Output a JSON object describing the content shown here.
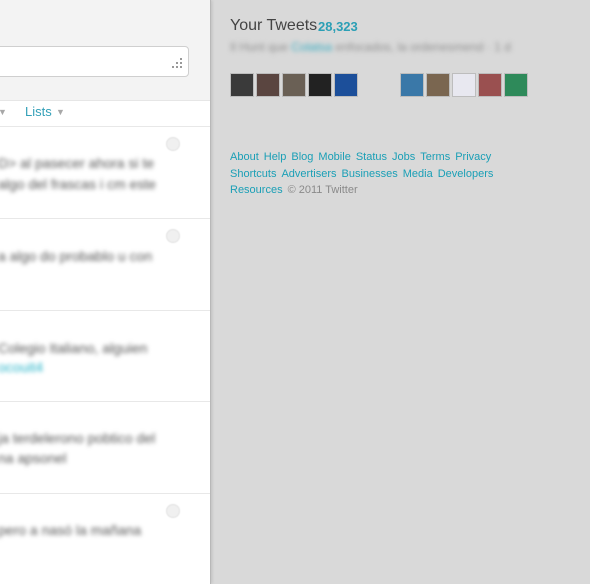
{
  "timeline": {
    "search_placeholder": "",
    "tabs": [
      {
        "label": "Lists"
      }
    ],
    "tweets": [
      {
        "lines": [
          "D> al pasecer ahora si te",
          "algo del frascas i cm este"
        ]
      },
      {
        "lines": [
          "a algo do probablo u con"
        ]
      },
      {
        "lines": [
          "Colegio Italiano, alguien",
          "ocouit4"
        ]
      },
      {
        "lines": [
          "ja terdelerono pobtico del",
          "na apsonel"
        ]
      },
      {
        "lines": [
          "pero a nasó la mañana"
        ]
      }
    ]
  },
  "dashboard": {
    "your_tweets_label": "Your Tweets",
    "tweet_count": "28,323",
    "latest_tweet_prefix": "Il Hunt que",
    "latest_tweet_link": "Colatsa",
    "latest_tweet_suffix": "enfocados, la ordenesmend · 1 d",
    "avatars": [
      {
        "icon": "user-avatar-1-icon",
        "color": "#3a3a3a"
      },
      {
        "icon": "user-avatar-2-icon",
        "color": "#5a4540"
      },
      {
        "icon": "user-avatar-3-icon",
        "color": "#6a6055"
      },
      {
        "icon": "user-avatar-4-icon",
        "color": "#222222"
      },
      {
        "icon": "user-avatar-5-icon",
        "color": "#1c4f9a"
      },
      {
        "icon": "user-avatar-6-icon",
        "color": "#3a78a8"
      },
      {
        "icon": "user-avatar-7-icon",
        "color": "#7a6650"
      },
      {
        "icon": "user-avatar-8-icon",
        "color": "#e8e8f0"
      },
      {
        "icon": "user-avatar-9-icon",
        "color": "#9a5050"
      },
      {
        "icon": "user-avatar-10-icon",
        "color": "#2e8a5a"
      }
    ]
  },
  "footer": {
    "links": [
      "About",
      "Help",
      "Blog",
      "Mobile",
      "Status",
      "Jobs",
      "Terms",
      "Privacy",
      "Shortcuts",
      "Advertisers",
      "Businesses",
      "Media",
      "Developers",
      "Resources"
    ],
    "copyright": "© 2011 Twitter"
  },
  "colors": {
    "accent": "#2b9fb5",
    "background": "#d9d9d9"
  }
}
